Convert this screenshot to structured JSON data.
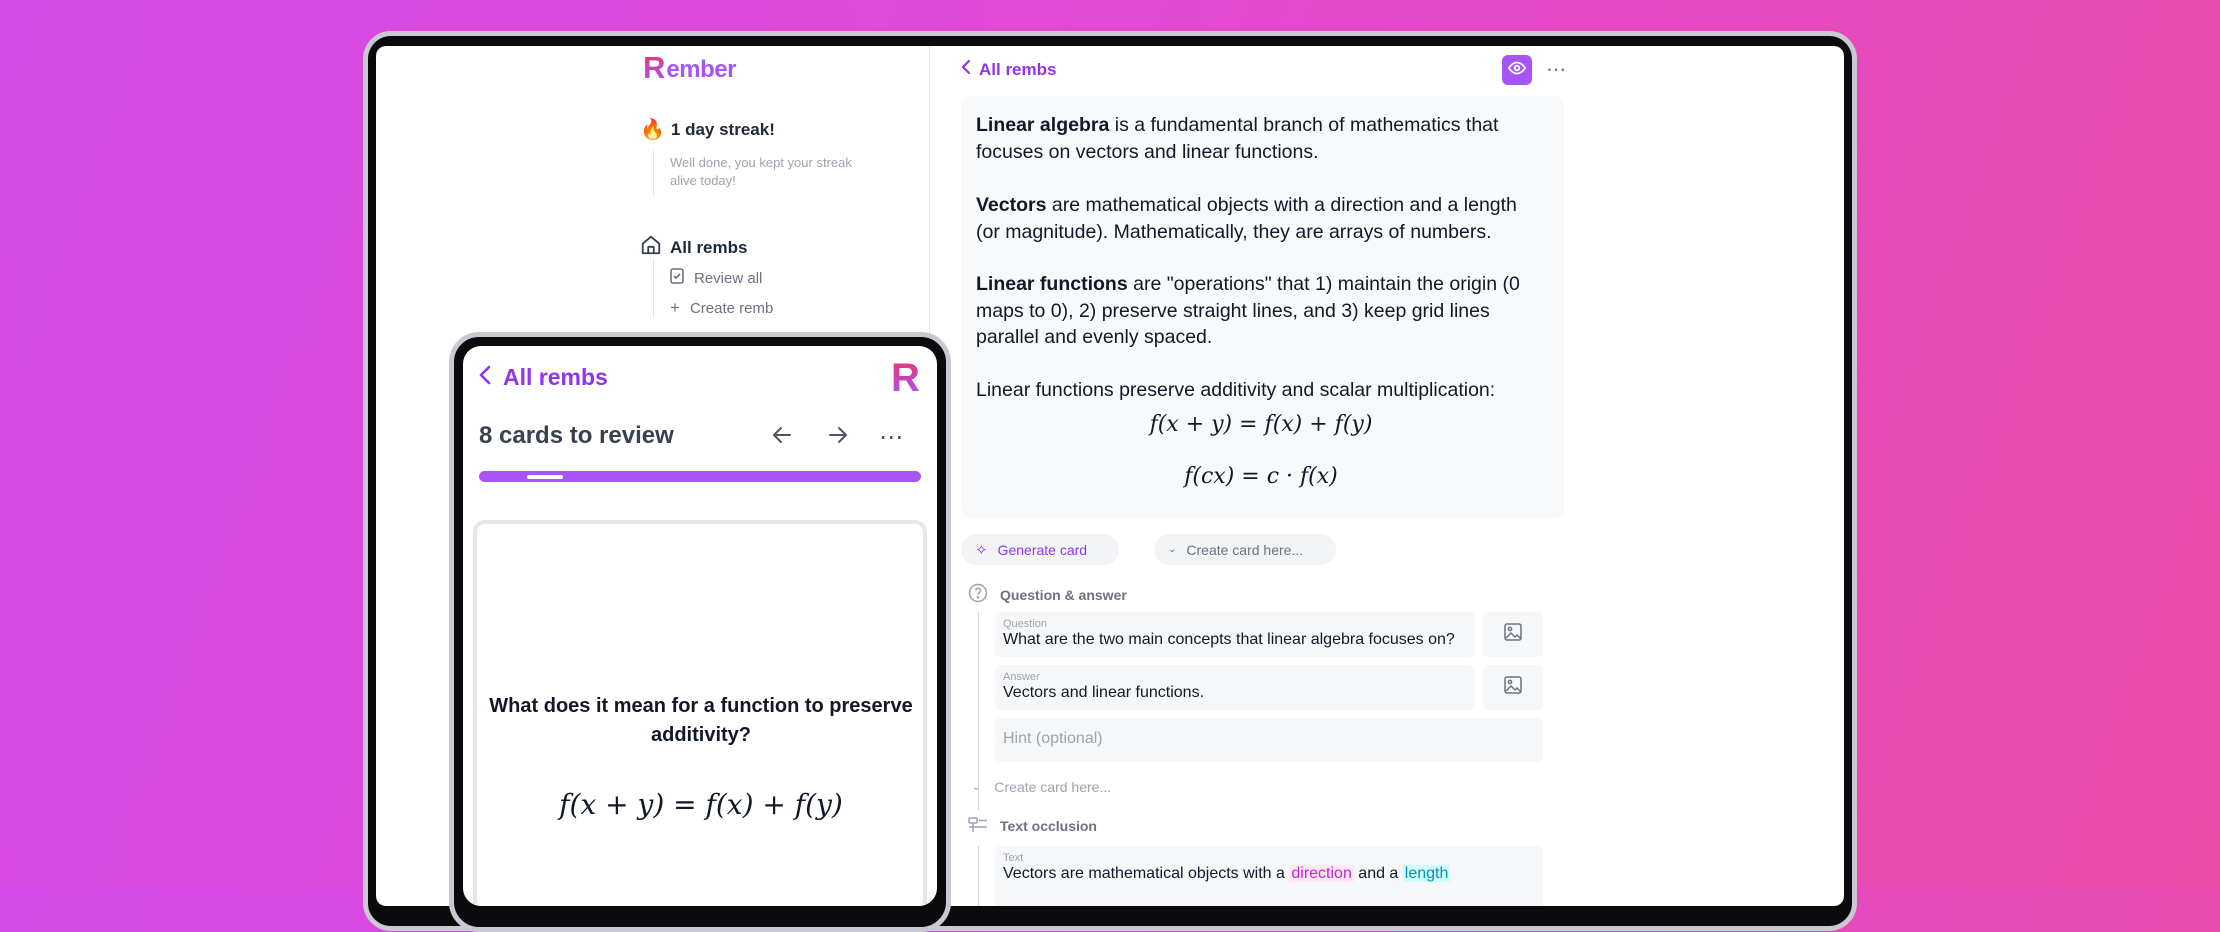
{
  "sidebar": {
    "logo": "Rember",
    "streak": {
      "title": "1 day streak!",
      "subtitle": "Well done, you kept your streak alive today!"
    },
    "nav": {
      "all_rembs": "All rembs",
      "review_all": "Review all",
      "create_remb": "Create remb"
    }
  },
  "main": {
    "back_label": "All rembs",
    "note": {
      "p1_bold": "Linear algebra",
      "p1_rest": " is a fundamental branch of mathematics that focuses on vectors and linear functions.",
      "p2_bold": "Vectors",
      "p2_rest": " are mathematical objects with a direction and a length (or magnitude). Mathematically, they are arrays of numbers.",
      "p3_bold": "Linear functions",
      "p3_rest": " are \"operations\" that 1) maintain the origin (0 maps to 0), 2) preserve straight lines, and 3) keep grid lines parallel and evenly spaced.",
      "p4": "Linear functions preserve additivity and scalar multiplication:",
      "formula1": "f(x + y) = f(x) + f(y)",
      "formula2": "f(cx) = c · f(x)"
    },
    "generate_card": "Generate card",
    "create_card_here": "Create card here...",
    "qa": {
      "title": "Question & answer",
      "question_label": "Question",
      "question_value": "What are the two main concepts that linear algebra focuses on?",
      "answer_label": "Answer",
      "answer_value": "Vectors and linear functions.",
      "hint_placeholder": "Hint (optional)"
    },
    "create_card_here_2": "Create card here...",
    "occlusion": {
      "title": "Text occlusion",
      "text_label": "Text",
      "text_prefix": "Vectors are mathematical objects with a ",
      "hl1": "direction",
      "text_mid": " and a ",
      "hl2": "length"
    }
  },
  "phone": {
    "back_label": "All rembs",
    "logo": "R",
    "title": "8 cards to review",
    "question": "What does it mean for a function to preserve additivity?",
    "formula": "f(x + y) = f(x) + f(y)"
  },
  "colors": {
    "accent": "#a855f7",
    "background_start": "#d54ae9",
    "background_end": "#ec4aa6"
  }
}
